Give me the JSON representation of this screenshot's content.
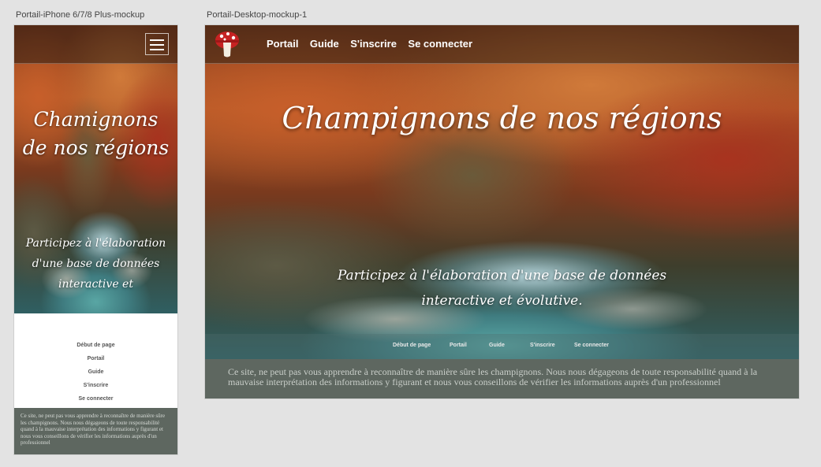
{
  "artboards": {
    "mobile_label": "Portail-iPhone 6/7/8 Plus-mockup",
    "desktop_label": "Portail-Desktop-mockup-1"
  },
  "mobile": {
    "title": "Chamignons de nos régions",
    "subtitle": "Participez à l'élaboration d'une base de données interactive et",
    "nav": [
      "Début de page",
      "Portail",
      "Guide",
      "S'inscrire",
      "Se connecter"
    ],
    "disclaimer": "Ce site, ne peut pas vous apprendre à reconnaître de manière sûre les champignons. Nous nous dégageons de toute responsabilité quand à la mauvaise interprétation des informations y figurant et nous vous conseillons de vérifier les informations auprès d'un professionnel"
  },
  "desktop": {
    "nav": [
      "Portail",
      "Guide",
      "S'inscrire",
      "Se connecter"
    ],
    "title": "Champignons de nos régions",
    "subtitle": "Participez à l'élaboration d'une base de données interactive et évolutive.",
    "footer_nav": [
      "Début de page",
      "Portail",
      "Guide",
      "S'inscrire",
      "Se connecter"
    ],
    "disclaimer": "Ce site, ne peut pas vous apprendre à reconnaître de manière sûre les champignons. Nous nous dégageons de toute responsabilité quand à la mauvaise interprétation des informations y figurant et nous vous conseillons de vérifier les informations auprès d'un professionnel"
  },
  "icons": {
    "menu": "hamburger-menu-icon",
    "logo": "mushroom-logo-icon"
  },
  "colors": {
    "disclaimer_bg": "#5e6760",
    "canvas_bg": "#e3e3e3"
  }
}
